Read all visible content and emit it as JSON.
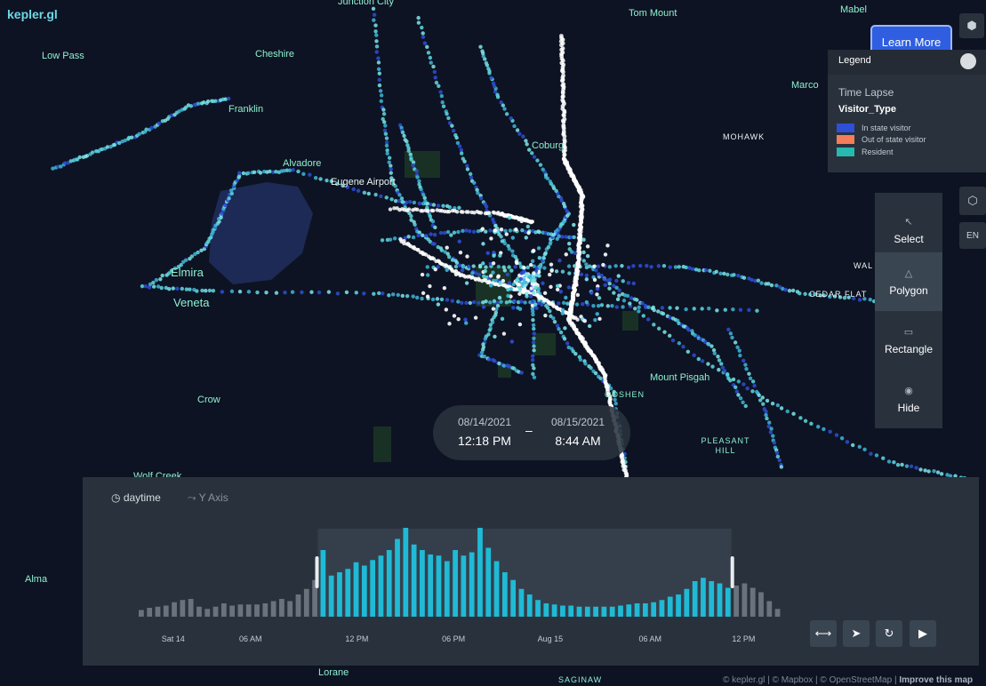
{
  "app": {
    "logo_text": "kepler.gl"
  },
  "map_labels": [
    "Tom Mount",
    "Mabel",
    "Low Pass",
    "Cheshire",
    "Franklin",
    "Alvadore",
    "Eugene Airport",
    "Elmira",
    "Veneta",
    "Crow",
    "Mount Pisgah",
    "MOHAWK",
    "CEDAR FLAT",
    "GOSHEN",
    "PLEASANT HILL",
    "Wolf Creek",
    "Alma",
    "Lorane",
    "Marco",
    "Coburg",
    "WAL",
    "SAGINAW",
    "Junction City"
  ],
  "learn_more_label": "Learn More",
  "legend": {
    "header": "Legend",
    "layer": "Time Lapse",
    "field": "Visitor_Type",
    "items": [
      {
        "label": "In state visitor",
        "color": "#2f4fd6"
      },
      {
        "label": "Out of state visitor",
        "color": "#f47d5a"
      },
      {
        "label": "Resident",
        "color": "#27b8b0"
      }
    ]
  },
  "side_buttons": {
    "language": "EN"
  },
  "draw_tools": [
    {
      "label": "Select",
      "icon": "cursor-icon",
      "active": false
    },
    {
      "label": "Polygon",
      "icon": "polygon-icon",
      "active": true
    },
    {
      "label": "Rectangle",
      "icon": "rectangle-icon",
      "active": false
    },
    {
      "label": "Hide",
      "icon": "eye-icon",
      "active": false
    }
  ],
  "time_range": {
    "start_date": "08/14/2021",
    "start_time": "12:18 PM",
    "separator": "–",
    "end_date": "08/15/2021",
    "end_time": "8:44 AM"
  },
  "timeline": {
    "field": "daytime",
    "y_axis_label": "Y Axis",
    "x_ticks": [
      "Sat 14",
      "06 AM",
      "12 PM",
      "06 PM",
      "Aug 15",
      "06 AM",
      "12 PM"
    ],
    "bars": [
      6,
      8,
      9,
      10,
      13,
      15,
      16,
      9,
      7,
      9,
      12,
      10,
      11,
      11,
      11,
      12,
      14,
      16,
      14,
      20,
      25,
      33,
      60,
      37,
      40,
      43,
      49,
      46,
      51,
      55,
      60,
      70,
      80,
      65,
      60,
      56,
      55,
      50,
      60,
      55,
      58,
      80,
      62,
      50,
      40,
      33,
      25,
      20,
      15,
      12,
      11,
      10,
      10,
      9,
      9,
      9,
      9,
      9,
      10,
      11,
      12,
      12,
      13,
      15,
      18,
      20,
      25,
      32,
      35,
      32,
      30,
      26,
      28,
      30,
      26,
      22,
      14,
      7
    ],
    "selected_from": 22,
    "selected_to": 71
  },
  "attribution": {
    "text": "© kepler.gl | © Mapbox | © OpenStreetMap | ",
    "improve": "Improve this map"
  }
}
